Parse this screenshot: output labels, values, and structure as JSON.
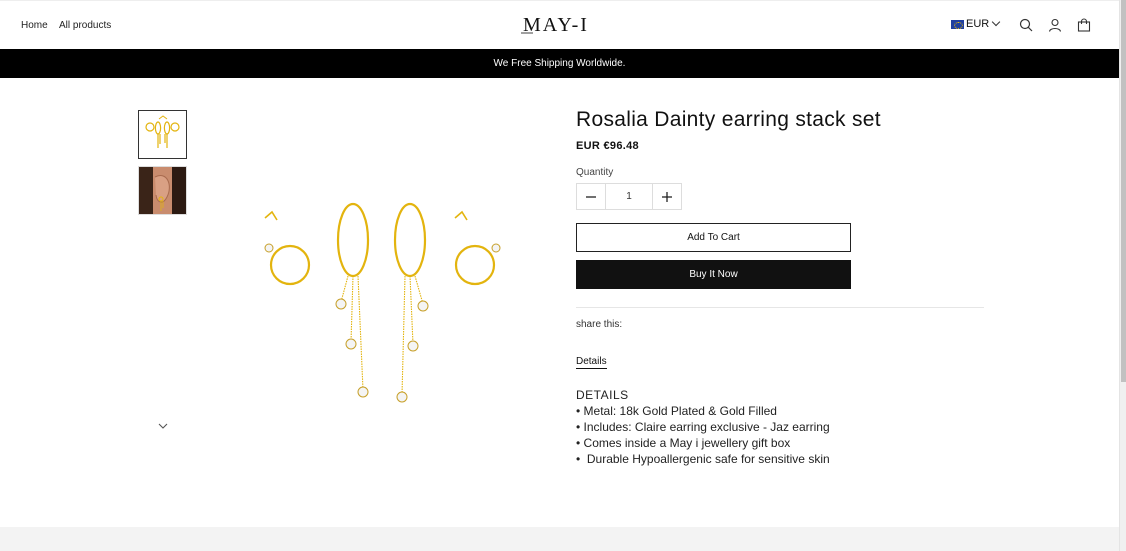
{
  "header": {
    "nav": [
      {
        "label": "Home"
      },
      {
        "label": "All products"
      }
    ],
    "logo_text": "MAY-I",
    "currency": "EUR",
    "icons": [
      "search-icon",
      "account-icon",
      "cart-icon",
      "eu-flag-icon",
      "chevron-down-icon"
    ]
  },
  "announcement": "We Free Shipping Worldwide.",
  "gallery": {
    "thumbnails": [
      "earring-set-thumbnail",
      "model-ear-thumbnail"
    ],
    "scroll_icon": "chevron-down-icon"
  },
  "product": {
    "title": "Rosalia Dainty earring stack set",
    "price": "EUR €96.48",
    "quantity_label": "Quantity",
    "quantity_value": "1",
    "add_to_cart": "Add To Cart",
    "buy_now": "Buy It Now",
    "share_label": "share this:",
    "details_tab": "Details",
    "description": [
      "DETAILS",
      "• Metal: 18k Gold Plated & Gold Filled",
      "• Includes: Claire earring exclusive - Jaz earring",
      "• Comes inside a May i jewellery gift box",
      "•  Durable Hypoallergenic safe for sensitive skin"
    ]
  },
  "colors": {
    "announce_bg": "#000000",
    "buy_bg": "#111111",
    "gold": "#e3b40e"
  }
}
